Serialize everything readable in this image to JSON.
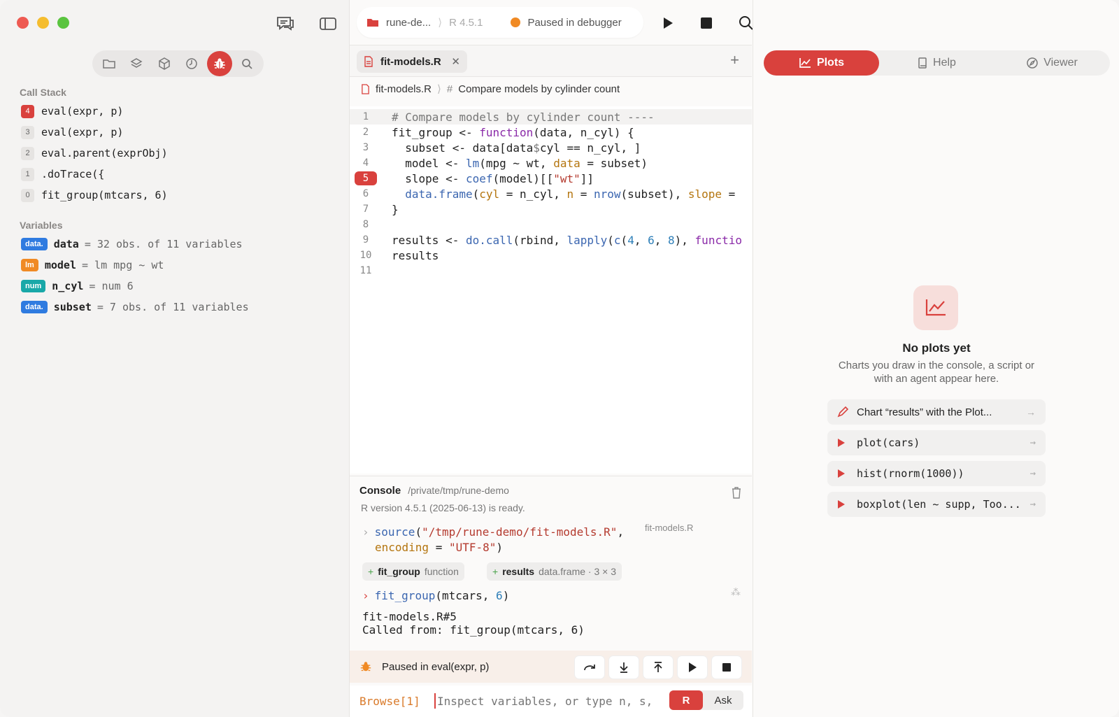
{
  "sidebar": {
    "call_stack_title": "Call Stack",
    "frames": [
      {
        "num": "4",
        "label": "eval(expr, p)"
      },
      {
        "num": "3",
        "label": "eval(expr, p)"
      },
      {
        "num": "2",
        "label": "eval.parent(exprObj)"
      },
      {
        "num": "1",
        "label": ".doTrace({"
      },
      {
        "num": "0",
        "label": "fit_group(mtcars, 6)"
      }
    ],
    "variables_title": "Variables",
    "variables": [
      {
        "badge": "data.",
        "badge_color": "#2f7be0",
        "name": "data",
        "value": "= 32 obs. of 11 variables"
      },
      {
        "badge": "lm",
        "badge_color": "#f08a24",
        "name": "model",
        "value": "= lm mpg ~ wt"
      },
      {
        "badge": "num",
        "badge_color": "#19a8a8",
        "name": "n_cyl",
        "value": "= num 6"
      },
      {
        "badge": "data.",
        "badge_color": "#2f7be0",
        "name": "subset",
        "value": "= 7 obs. of 11 variables"
      }
    ]
  },
  "topbar": {
    "project": "rune-de...",
    "r_version": "R 4.5.1",
    "status": "Paused in debugger"
  },
  "editor": {
    "tab_label": "fit-models.R",
    "breadcrumb_file": "fit-models.R",
    "breadcrumb_section": "Compare models by cylinder count",
    "line_numbers": [
      "1",
      "2",
      "3",
      "4",
      "5",
      "6",
      "7",
      "8",
      "9",
      "10",
      "11"
    ]
  },
  "console": {
    "title": "Console",
    "path": "/private/tmp/rune-demo",
    "ready": "R version 4.5.1 (2025-06-13) is ready.",
    "source_file_tag": "fit-models.R",
    "chip1_name": "fit_group",
    "chip1_type": "function",
    "chip2_name": "results",
    "chip2_type": "data.frame · 3 × 3",
    "output_line1": "fit-models.R#5",
    "output_line2": "Called from: fit_group(mtcars, 6)",
    "paused_label": "Paused in eval(expr, p)",
    "browse_prompt": "Browse[1]",
    "input_placeholder": "Inspect variables, or type n, s,",
    "mode_r": "R",
    "mode_ask": "Ask"
  },
  "right": {
    "tabs": [
      "Plots",
      "Help",
      "Viewer"
    ],
    "empty_title": "No plots yet",
    "empty_desc1": "Charts you draw in the console, a script or",
    "empty_desc2": "with an agent appear here.",
    "suggestions": [
      "Chart “results” with the Plot...",
      "plot(cars)",
      "hist(rnorm(1000))",
      "boxplot(len ~ supp, Too..."
    ]
  }
}
